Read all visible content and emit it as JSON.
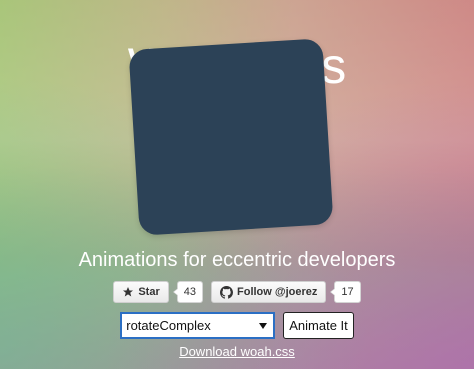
{
  "hero": {
    "title": "Woah.css"
  },
  "tagline": "Animations for eccentric developers",
  "github": {
    "star_label": "Star",
    "star_count": "43",
    "follow_label": "Follow @joerez",
    "follow_count": "17"
  },
  "controls": {
    "selected_animation": "rotateComplex",
    "animate_label": "Animate It"
  },
  "download": {
    "label": "Download woah.css"
  },
  "colors": {
    "box": "#2c4257",
    "select_border": "#2b6fc4"
  },
  "icons": {
    "star": "star-icon",
    "github": "github-icon",
    "dropdown": "chevron-down-icon"
  }
}
